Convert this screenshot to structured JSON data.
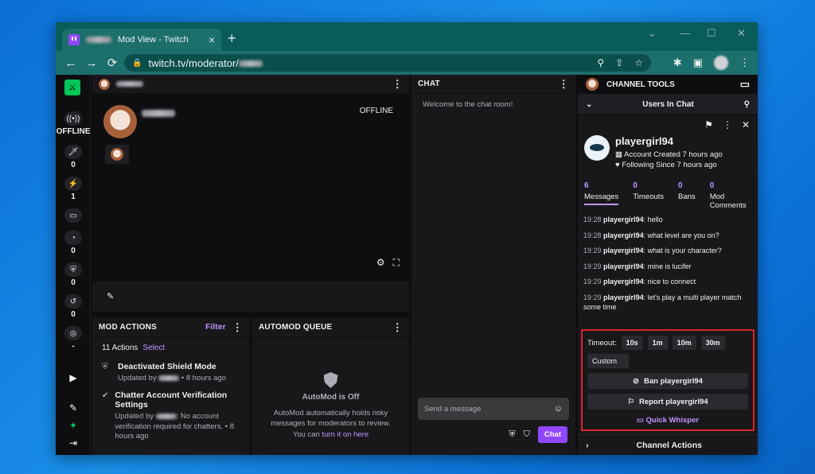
{
  "browser": {
    "tab_title": "Mod View - Twitch",
    "url_host": "twitch.tv/moderator/",
    "back": "←",
    "forward": "→",
    "reload": "⟳",
    "close": "×",
    "new_tab": "+"
  },
  "rail": {
    "offline_label": "OFFLINE",
    "counts": [
      "0",
      "1",
      "",
      "0",
      "0",
      "0",
      "-"
    ]
  },
  "stream": {
    "status": "OFFLINE"
  },
  "mod_actions": {
    "title": "MOD ACTIONS",
    "filter": "Filter",
    "count": "11 Actions",
    "select": "Select",
    "items": [
      {
        "title": "Deactivated Shield Mode",
        "by": "Updated by",
        "time": "• 8 hours ago"
      },
      {
        "title": "Chatter Account Verification Settings",
        "by": "Updated by",
        "detail": ": No account verification required for chatters. • 8 hours ago"
      }
    ]
  },
  "automod": {
    "title": "AUTOMOD QUEUE",
    "status": "AutoMod is Off",
    "desc": "AutoMod automatically holds risky messages for moderators to review. You can ",
    "link": "turn it on here"
  },
  "chat": {
    "title": "CHAT",
    "welcome": "Welcome to the chat room!",
    "placeholder": "Send a message",
    "chat_button": "Chat"
  },
  "tools": {
    "title": "CHANNEL TOOLS",
    "users_in_chat": "Users In Chat",
    "username": "playergirl94",
    "created": "Account Created 7 hours ago",
    "following": "Following Since 7 hours ago",
    "stats": [
      {
        "n": "6",
        "l": "Messages"
      },
      {
        "n": "0",
        "l": "Timeouts"
      },
      {
        "n": "0",
        "l": "Bans"
      },
      {
        "n": "0",
        "l": "Mod Comments"
      }
    ],
    "messages": [
      {
        "t": "19:28",
        "u": "playergirl94",
        "m": ": hello"
      },
      {
        "t": "19:28",
        "u": "playergirl94",
        "m": ": what level are you on?"
      },
      {
        "t": "19:29",
        "u": "playergirl94",
        "m": ": what is your character?"
      },
      {
        "t": "19:29",
        "u": "playergirl94",
        "m": ": mine is lucifer"
      },
      {
        "t": "19:29",
        "u": "playergirl94",
        "m": ": nice to connect"
      },
      {
        "t": "19:29",
        "u": "playergirl94",
        "m": ": let's play a multi player match some time"
      }
    ],
    "timeout_label": "Timeout:",
    "timeouts": [
      "10s",
      "1m",
      "10m",
      "30m"
    ],
    "custom": "Custom",
    "ban": "Ban playergirl94",
    "report": "Report playergirl94",
    "whisper": "Quick Whisper",
    "channel_actions": "Channel Actions"
  },
  "colors": {
    "accent": "#9147ff",
    "link": "#bf94ff",
    "highlight": "#d9232a"
  }
}
